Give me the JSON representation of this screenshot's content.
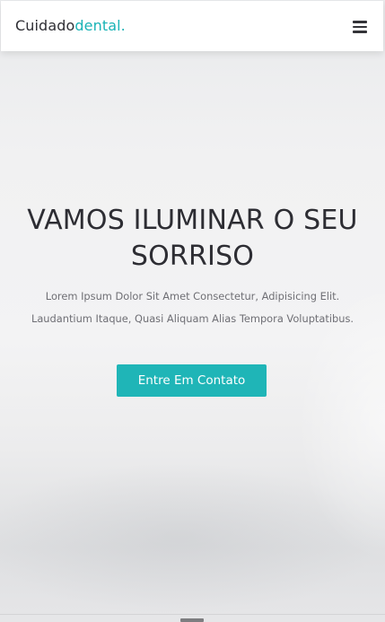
{
  "header": {
    "logo_primary": "Cuidado",
    "logo_accent": "dental.",
    "menu_icon": "hamburger-menu-icon"
  },
  "hero": {
    "title": "VAMOS ILUMINAR O SEU SORRISO",
    "description": "Lorem Ipsum Dolor Sit Amet Consectetur, Adipisicing Elit. Laudantium Itaque, Quasi Aliquam Alias Tempora Voluptatibus.",
    "cta_label": "Entre Em Contato"
  },
  "colors": {
    "accent": "#1fb5b7",
    "title_text": "#2d2d33",
    "body_text": "#6f6f75",
    "header_bg": "#ffffff"
  }
}
